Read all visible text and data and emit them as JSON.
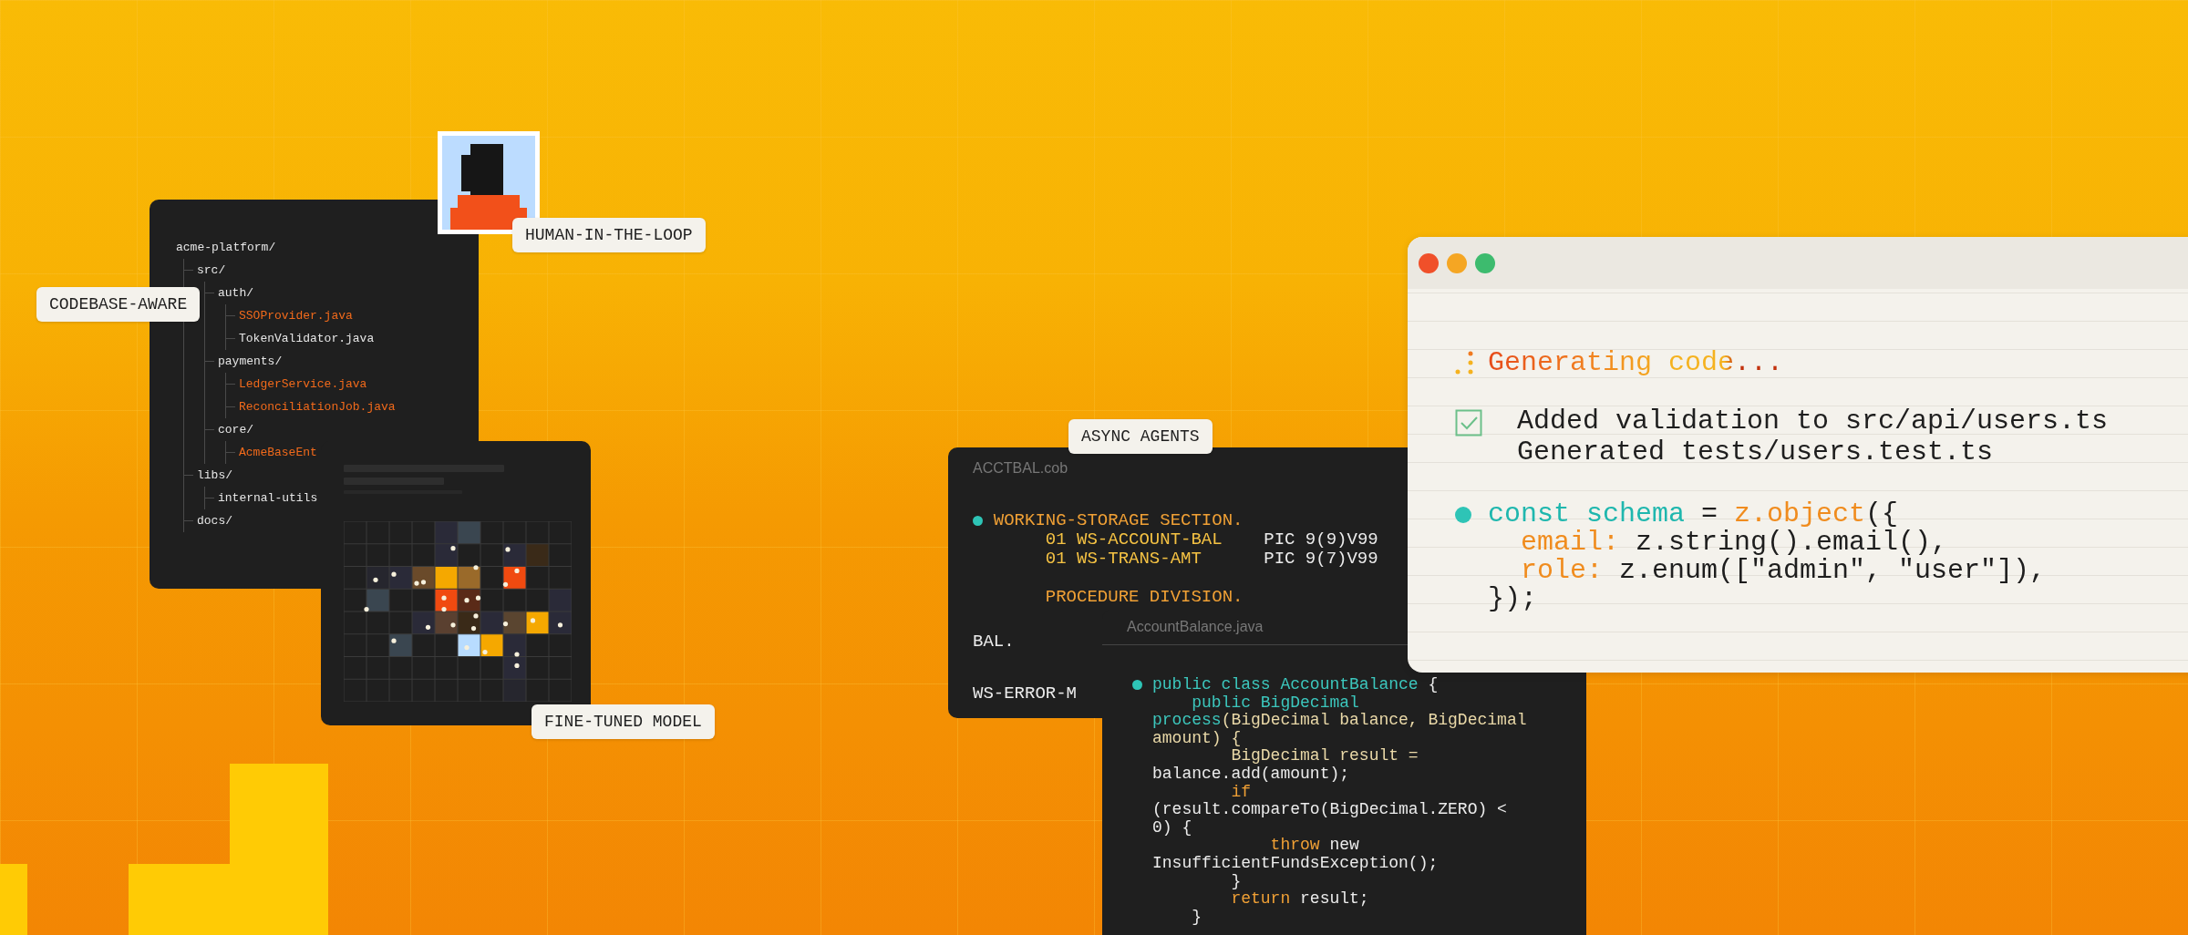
{
  "file_tree": {
    "label": "CODEBASE-AWARE",
    "root": {
      "name": "acme-platform/",
      "highlighted": false,
      "children": [
        {
          "name": "src/",
          "highlighted": false,
          "children": [
            {
              "name": "auth/",
              "highlighted": false,
              "children": [
                {
                  "name": "SSOProvider.java",
                  "highlighted": true
                },
                {
                  "name": "TokenValidator.java",
                  "highlighted": false
                }
              ]
            },
            {
              "name": "payments/",
              "highlighted": false,
              "children": [
                {
                  "name": "LedgerService.java",
                  "highlighted": true
                },
                {
                  "name": "ReconciliationJob.java",
                  "highlighted": true
                }
              ]
            },
            {
              "name": "core/",
              "highlighted": false,
              "children": [
                {
                  "name": "AcmeBaseEnt",
                  "highlighted": true
                }
              ]
            }
          ]
        },
        {
          "name": "libs/",
          "highlighted": false,
          "children": [
            {
              "name": "internal-utils",
              "highlighted": false
            }
          ]
        },
        {
          "name": "docs/",
          "highlighted": false
        }
      ]
    }
  },
  "reviewer": {
    "label": "HUMAN-IN-THE-LOOP"
  },
  "model_panel": {
    "label": "FINE-TUNED MODEL"
  },
  "legacy_file": {
    "label": "ASYNC AGENTS",
    "filename": "ACCTBAL.cob",
    "blocks": [
      {
        "marked": true,
        "lines": [
          [
            {
              "text": "WORKING-STORAGE SECTION.",
              "kind": "accent"
            }
          ],
          [
            {
              "text": "       01 WS-ACCOUNT-BAL",
              "kind": "name"
            },
            {
              "text": "    PIC 9(9)V99",
              "kind": "plain"
            }
          ],
          [
            {
              "text": "       01 WS-TRANS-AMT",
              "kind": "name"
            },
            {
              "text": "      PIC 9(7)V99",
              "kind": "plain"
            }
          ]
        ]
      },
      {
        "marked": false,
        "lines": [
          [
            {
              "text": "       PROCEDURE DIVISION.",
              "kind": "accent"
            }
          ]
        ]
      },
      {
        "marked": false,
        "lines": [
          [
            {
              "text": "BAL.",
              "kind": "plain"
            }
          ]
        ]
      },
      {
        "marked": false,
        "lines": [
          [
            {
              "text": "WS-ERROR-M",
              "kind": "plain"
            }
          ]
        ]
      }
    ]
  },
  "java_file": {
    "filename": "AccountBalance.java",
    "blocks": [
      {
        "marked": true,
        "lines": [
          [
            {
              "text": "public class AccountBalance",
              "kind": "keyword"
            },
            {
              "text": " {",
              "kind": "plain"
            }
          ],
          [
            {
              "text": "    public BigDecimal",
              "kind": "keyword"
            }
          ],
          [
            {
              "text": "process",
              "kind": "keyword"
            },
            {
              "text": "(BigDecimal balance, BigDecimal",
              "kind": "type"
            }
          ],
          [
            {
              "text": "amount) {",
              "kind": "type"
            }
          ],
          [
            {
              "text": "        BigDecimal result =",
              "kind": "type"
            }
          ],
          [
            {
              "text": "balance.add(amount);",
              "kind": "plain"
            }
          ],
          [
            {
              "text": "        if",
              "kind": "accent"
            }
          ],
          [
            {
              "text": "(result.compareTo(BigDecimal.ZERO) <",
              "kind": "plain"
            }
          ],
          [
            {
              "text": "0) {",
              "kind": "plain"
            }
          ],
          [
            {
              "text": "            throw",
              "kind": "accent"
            },
            {
              "text": " new",
              "kind": "plain"
            }
          ],
          [
            {
              "text": "InsufficientFundsException();",
              "kind": "plain"
            }
          ],
          [
            {
              "text": "        }",
              "kind": "plain"
            }
          ],
          [
            {
              "text": "        return",
              "kind": "accent"
            },
            {
              "text": " result;",
              "kind": "plain"
            }
          ],
          [
            {
              "text": "    }",
              "kind": "plain"
            }
          ]
        ]
      }
    ]
  },
  "editor_window": {
    "status": "Generating code...",
    "tasks": {
      "checked": true,
      "lines": [
        "Added validation to src/api/users.ts",
        "Generated tests/users.test.ts"
      ]
    },
    "blocks": [
      {
        "marked": true,
        "lines": [
          [
            {
              "text": "const schema",
              "kind": "keyword"
            },
            {
              "text": " = ",
              "kind": "plain"
            },
            {
              "text": "z.object",
              "kind": "accent"
            },
            {
              "text": "({",
              "kind": "plain"
            }
          ],
          [
            {
              "text": "    email:",
              "kind": "accent"
            },
            {
              "text": " z.string().email(),",
              "kind": "plain"
            }
          ],
          [
            {
              "text": "    role:",
              "kind": "accent"
            },
            {
              "text": " z.enum([\"admin\", \"user\"]),",
              "kind": "plain"
            }
          ],
          [
            {
              "text": "  });",
              "kind": "plain"
            }
          ]
        ]
      }
    ]
  }
}
